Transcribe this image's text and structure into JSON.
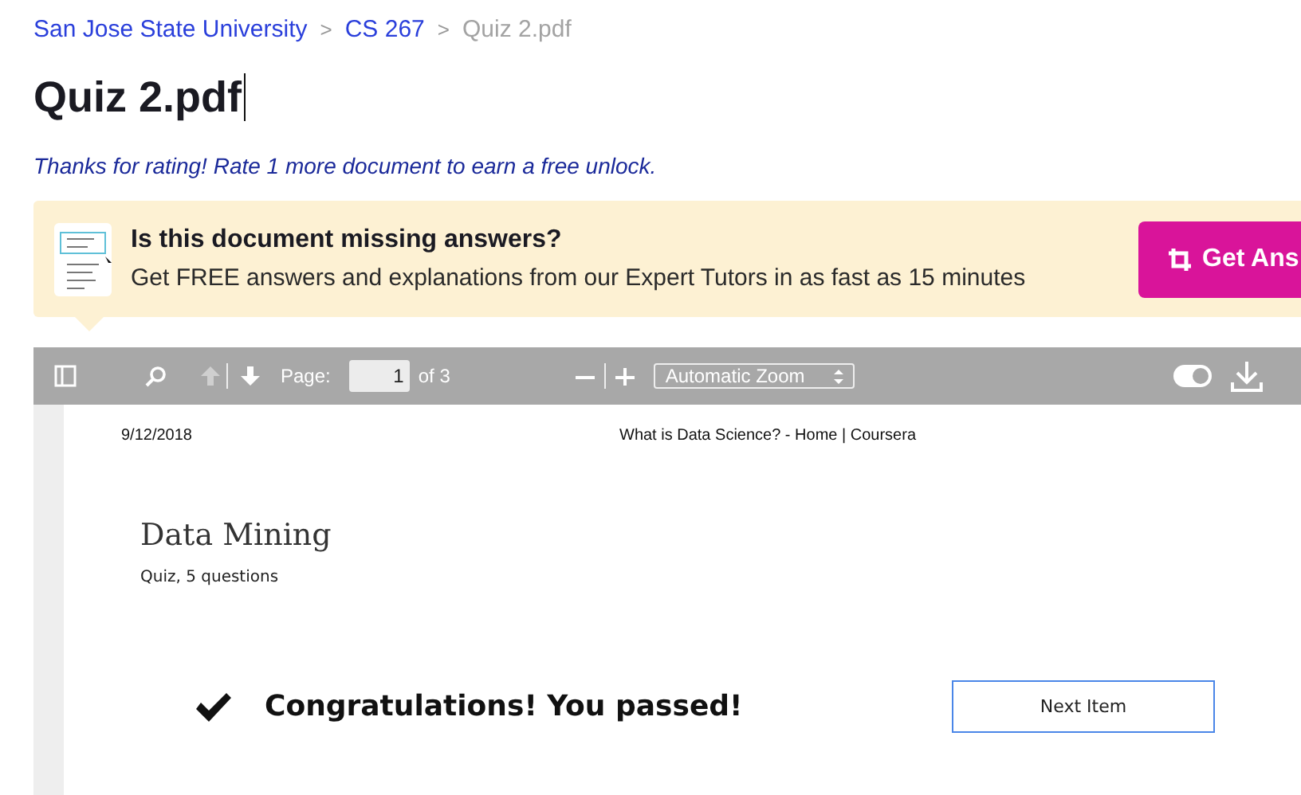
{
  "breadcrumb": [
    {
      "label": "San Jose State University",
      "current": false
    },
    {
      "label": "CS 267",
      "current": false
    },
    {
      "label": "Quiz 2.pdf",
      "current": true
    }
  ],
  "breadcrumb_separator": ">",
  "title": "Quiz 2.pdf",
  "rating_note": "Thanks for rating! Rate 1 more document to earn a free unlock.",
  "banner": {
    "heading": "Is this document missing answers?",
    "text": "Get FREE answers and explanations from our Expert Tutors in as fast as 15 minutes",
    "button": "Get Ans"
  },
  "viewer": {
    "page_label": "Page:",
    "page_value": "1",
    "page_total": "of 3",
    "zoom": "Automatic Zoom",
    "document": {
      "date": "9/12/2018",
      "header": "What is Data Science? - Home | Coursera",
      "course": "Data Mining",
      "subtitle": "Quiz, 5 questions",
      "result": "Congratulations! You passed!",
      "next_button": "Next Item"
    }
  }
}
